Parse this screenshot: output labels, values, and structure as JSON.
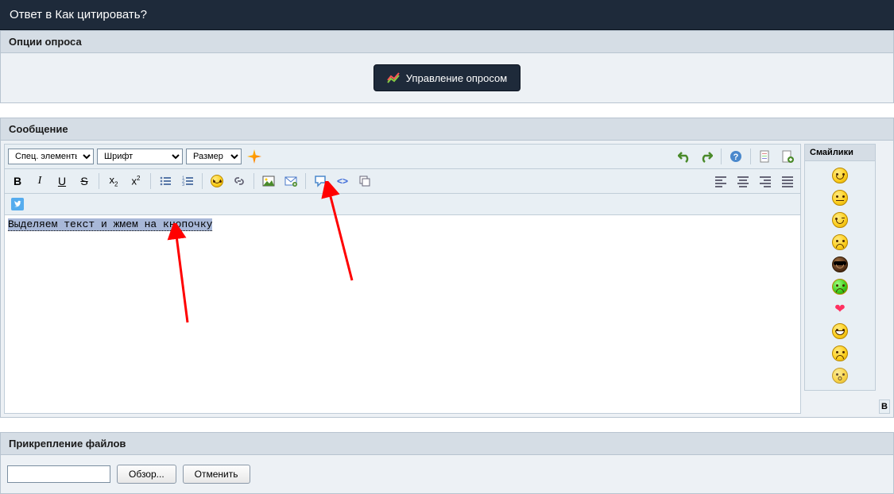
{
  "header": {
    "title": "Ответ в Как цитировать?"
  },
  "poll": {
    "header": "Опции опроса",
    "button": "Управление опросом"
  },
  "message": {
    "header": "Сообщение"
  },
  "toolbar": {
    "specials": "Спец. элементы",
    "font": "Шрифт",
    "size": "Размер"
  },
  "editor": {
    "text": "Выделяем текст и жмем на кнопочку"
  },
  "smilies": {
    "header": "Смайлики"
  },
  "attach": {
    "header": "Прикрепление файлов",
    "browse": "Обзор...",
    "cancel": "Отменить"
  },
  "letter": "В"
}
